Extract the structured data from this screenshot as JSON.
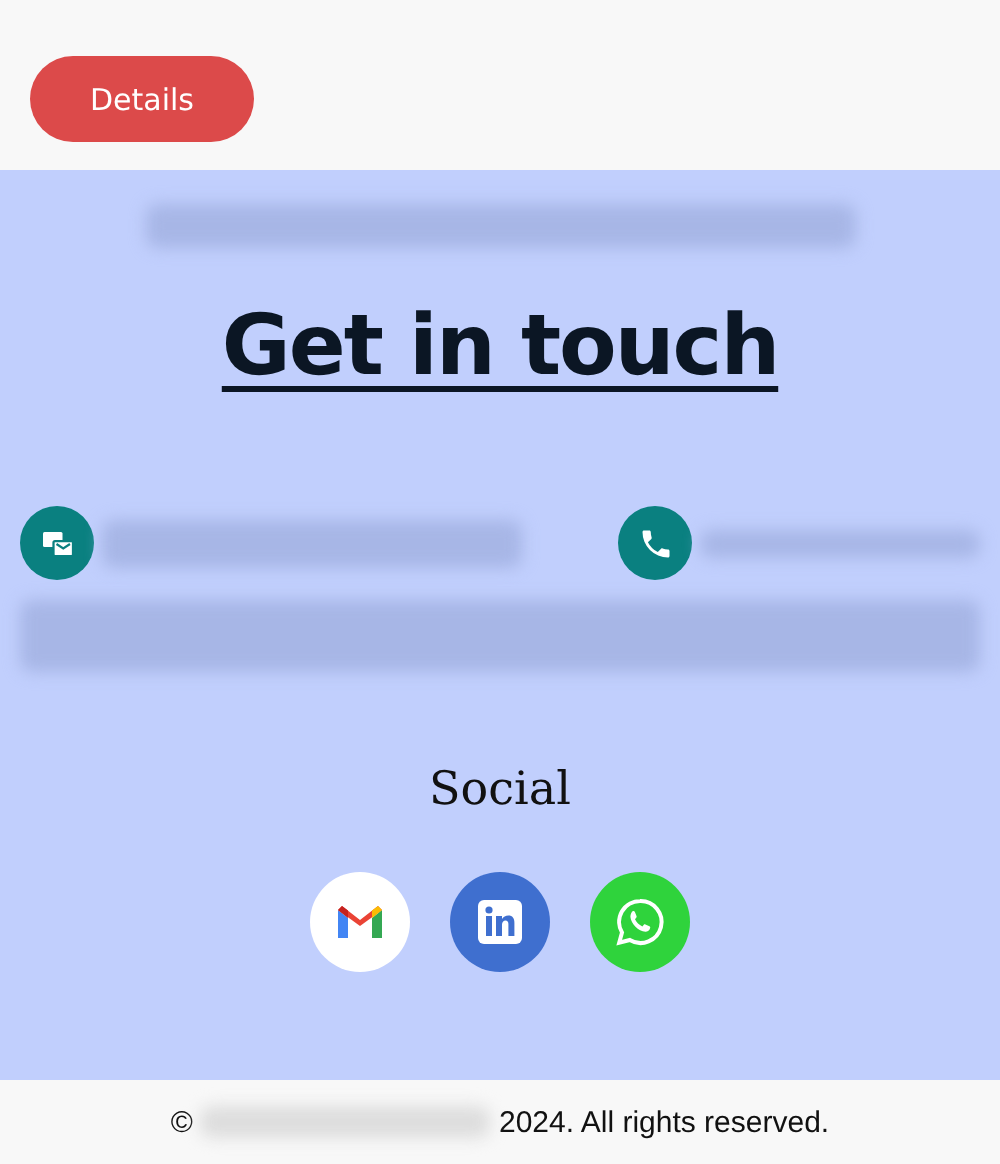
{
  "header": {
    "button": "Details"
  },
  "heading": "Get in touch",
  "contacts": [
    {
      "kind": "message"
    },
    {
      "kind": "phone"
    }
  ],
  "social": {
    "title": "Social",
    "links": [
      {
        "kind": "gmail"
      },
      {
        "kind": "linkedin"
      },
      {
        "kind": "whatsapp"
      }
    ]
  },
  "footer": {
    "symbol": "©",
    "text": "2024. All rights reserved."
  }
}
